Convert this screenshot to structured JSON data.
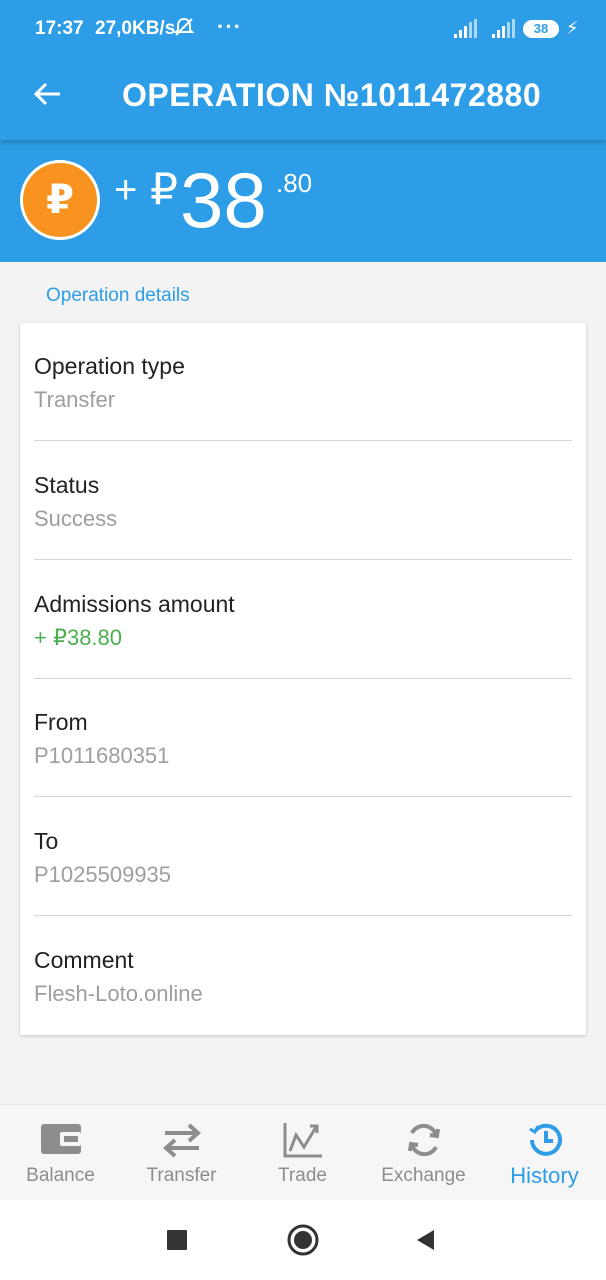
{
  "status_bar": {
    "time": "17:37",
    "speed": "27,0KB/s",
    "dots": "···",
    "battery": "38"
  },
  "app_bar": {
    "title": "OPERATION №1011472880"
  },
  "amount": {
    "sign": "+",
    "currency": "₽",
    "integer": "38",
    "decimal": ".80",
    "coin_symbol": "₽"
  },
  "section": {
    "label": "Operation details"
  },
  "details": [
    {
      "label": "Operation type",
      "value": "Transfer"
    },
    {
      "label": "Status",
      "value": "Success"
    },
    {
      "label": "Admissions amount",
      "value": "+ ₽38.80"
    },
    {
      "label": "From",
      "value": "P1011680351"
    },
    {
      "label": "To",
      "value": "P1025509935"
    },
    {
      "label": "Comment",
      "value": "Flesh-Loto.online"
    }
  ],
  "bottom_nav": [
    {
      "label": "Balance",
      "icon": "wallet-icon"
    },
    {
      "label": "Transfer",
      "icon": "transfer-arrows-icon"
    },
    {
      "label": "Trade",
      "icon": "chart-icon"
    },
    {
      "label": "Exchange",
      "icon": "refresh-icon"
    },
    {
      "label": "History",
      "icon": "history-icon",
      "active": true
    }
  ],
  "colors": {
    "primary": "#2d9de8",
    "coin": "#f7931e",
    "positive": "#4caf50",
    "muted": "#9e9e9e"
  }
}
